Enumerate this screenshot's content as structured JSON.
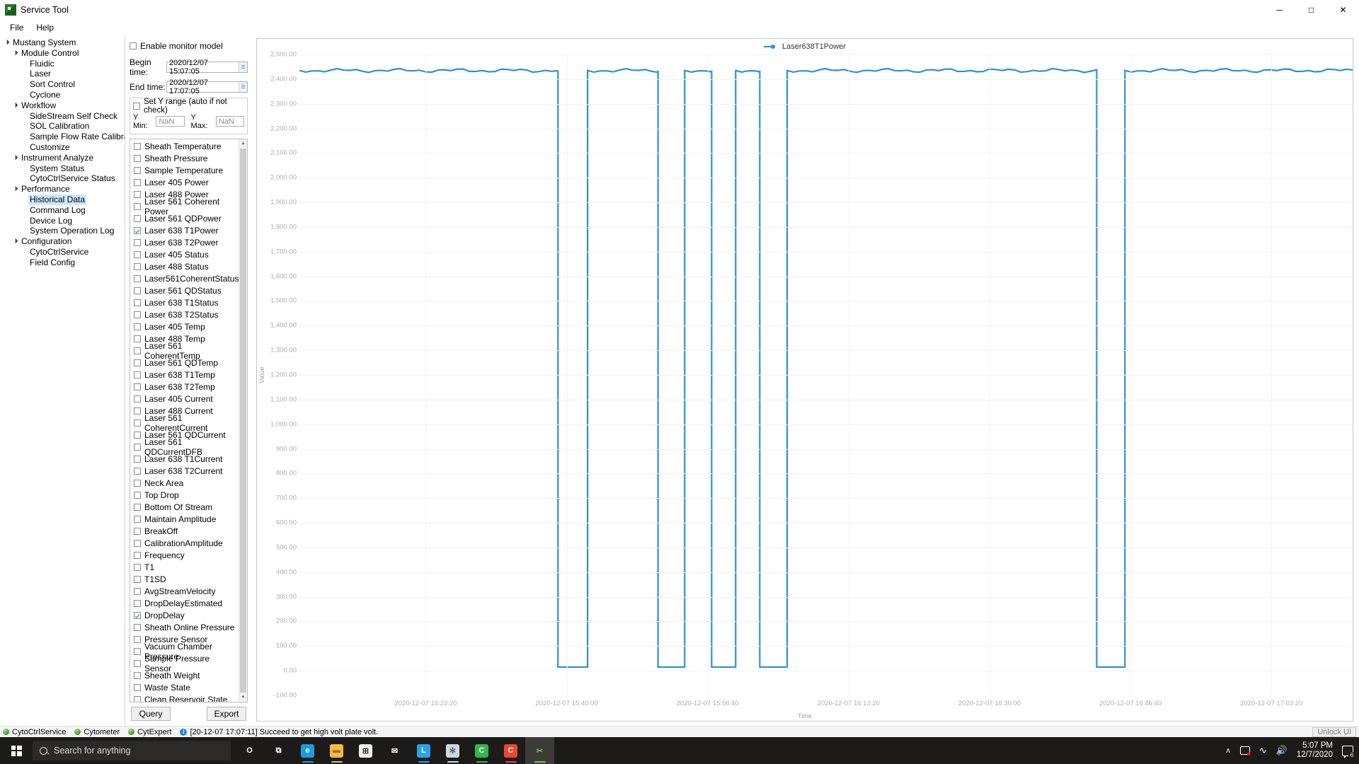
{
  "window": {
    "title": "Service Tool",
    "icon": "app-icon",
    "minimize": "─",
    "maximize": "□",
    "close": "✕"
  },
  "menubar": {
    "items": [
      "File",
      "Help"
    ]
  },
  "sidebar": {
    "items": [
      {
        "label": "Mustang System",
        "depth": 0,
        "arrow": "▴",
        "selected": false
      },
      {
        "label": "Module Control",
        "depth": 1,
        "arrow": "▴",
        "selected": false
      },
      {
        "label": "Fluidic",
        "depth": 2,
        "arrow": "",
        "selected": false
      },
      {
        "label": "Laser",
        "depth": 2,
        "arrow": "",
        "selected": false
      },
      {
        "label": "Sort Control",
        "depth": 2,
        "arrow": "",
        "selected": false
      },
      {
        "label": "Cyclone",
        "depth": 2,
        "arrow": "",
        "selected": false
      },
      {
        "label": "Workflow",
        "depth": 1,
        "arrow": "▴",
        "selected": false
      },
      {
        "label": "SideStream Self Check",
        "depth": 2,
        "arrow": "",
        "selected": false
      },
      {
        "label": "SOL Calibration",
        "depth": 2,
        "arrow": "",
        "selected": false
      },
      {
        "label": "Sample Flow Rate Calibration",
        "depth": 2,
        "arrow": "",
        "selected": false
      },
      {
        "label": "Customize",
        "depth": 2,
        "arrow": "",
        "selected": false
      },
      {
        "label": "Instrument Analyze",
        "depth": 1,
        "arrow": "▴",
        "selected": false
      },
      {
        "label": "System Status",
        "depth": 2,
        "arrow": "",
        "selected": false
      },
      {
        "label": "CytoCtrlService Status",
        "depth": 2,
        "arrow": "",
        "selected": false
      },
      {
        "label": "Performance",
        "depth": 1,
        "arrow": "▴",
        "selected": false
      },
      {
        "label": "Historical Data",
        "depth": 2,
        "arrow": "",
        "selected": true
      },
      {
        "label": "Command Log",
        "depth": 2,
        "arrow": "",
        "selected": false
      },
      {
        "label": "Device Log",
        "depth": 2,
        "arrow": "",
        "selected": false
      },
      {
        "label": "System Operation Log",
        "depth": 2,
        "arrow": "",
        "selected": false
      },
      {
        "label": "Configuration",
        "depth": 1,
        "arrow": "▴",
        "selected": false
      },
      {
        "label": "CytoCtrlService",
        "depth": 2,
        "arrow": "",
        "selected": false
      },
      {
        "label": "Field Config",
        "depth": 2,
        "arrow": "",
        "selected": false
      }
    ]
  },
  "controls": {
    "enable_monitor_label": "Enable monitor model",
    "enable_monitor_checked": false,
    "begin_time_label": "Begin time:",
    "begin_time_value": "2020/12/07 15:07:05",
    "end_time_label": "End time:",
    "end_time_value": "2020/12/07 17:07:05",
    "set_y_range_label": "Set Y range (auto if not check)",
    "set_y_range_checked": false,
    "y_min_label": "Y Min:",
    "y_min_value": "NaN",
    "y_max_label": "Y Max:",
    "y_max_value": "NaN",
    "query_button": "Query",
    "export_button": "Export",
    "scroll_up": "▲",
    "scroll_down": "▼"
  },
  "signal_list": [
    {
      "label": "Sheath Temperature",
      "checked": false
    },
    {
      "label": "Sheath Pressure",
      "checked": false
    },
    {
      "label": "Sample Temperature",
      "checked": false
    },
    {
      "label": "Laser 405 Power",
      "checked": false
    },
    {
      "label": "Laser 488 Power",
      "checked": false
    },
    {
      "label": "Laser 561 Coherent Power",
      "checked": false
    },
    {
      "label": "Laser 561 QDPower",
      "checked": false
    },
    {
      "label": "Laser 638 T1Power",
      "checked": true
    },
    {
      "label": "Laser 638 T2Power",
      "checked": false
    },
    {
      "label": "Laser 405 Status",
      "checked": false
    },
    {
      "label": "Laser 488 Status",
      "checked": false
    },
    {
      "label": "Laser561CoherentStatus",
      "checked": false
    },
    {
      "label": "Laser 561 QDStatus",
      "checked": false
    },
    {
      "label": "Laser 638 T1Status",
      "checked": false
    },
    {
      "label": "Laser 638 T2Status",
      "checked": false
    },
    {
      "label": "Laser 405 Temp",
      "checked": false
    },
    {
      "label": "Laser 488 Temp",
      "checked": false
    },
    {
      "label": "Laser 561 CoherentTemp",
      "checked": false
    },
    {
      "label": "Laser 561 QDTemp",
      "checked": false
    },
    {
      "label": "Laser 638 T1Temp",
      "checked": false
    },
    {
      "label": "Laser 638 T2Temp",
      "checked": false
    },
    {
      "label": "Laser 405 Current",
      "checked": false
    },
    {
      "label": "Laser 488 Current",
      "checked": false
    },
    {
      "label": "Laser 561 CoherentCurrent",
      "checked": false
    },
    {
      "label": "Laser 561 QDCurrent",
      "checked": false
    },
    {
      "label": "Laser 561 QDCurrentDFB",
      "checked": false
    },
    {
      "label": "Laser 638 T1Current",
      "checked": false
    },
    {
      "label": "Laser 638 T2Current",
      "checked": false
    },
    {
      "label": "Neck Area",
      "checked": false
    },
    {
      "label": "Top Drop",
      "checked": false
    },
    {
      "label": "Bottom Of Stream",
      "checked": false
    },
    {
      "label": "Maintain Amplitude",
      "checked": false
    },
    {
      "label": "BreakOff",
      "checked": false
    },
    {
      "label": "CalibrationAmplitude",
      "checked": false
    },
    {
      "label": "Frequency",
      "checked": false
    },
    {
      "label": "T1",
      "checked": false
    },
    {
      "label": "T1SD",
      "checked": false
    },
    {
      "label": "AvgStreamVelocity",
      "checked": false
    },
    {
      "label": "DropDelayEstimated",
      "checked": false
    },
    {
      "label": "DropDelay",
      "checked": true
    },
    {
      "label": "Sheath Online Pressure",
      "checked": false
    },
    {
      "label": "Pressure Sensor",
      "checked": false
    },
    {
      "label": "Vacuum Chamber Pressure",
      "checked": false
    },
    {
      "label": "Sample Pressure Sensor",
      "checked": false
    },
    {
      "label": "Sheath Weight",
      "checked": false
    },
    {
      "label": "Waste State",
      "checked": false
    },
    {
      "label": "Clean Reservoir State",
      "checked": false
    }
  ],
  "chart_data": {
    "type": "line",
    "title": "",
    "legend": [
      "Laser638T1Power"
    ],
    "legend_position": "top-center",
    "series_color": "#2f8fd6",
    "xlabel": "Time",
    "ylabel": "Value",
    "grid": true,
    "ylim": [
      -100,
      2500
    ],
    "yticks": [
      "2,500.00",
      "2,400.00",
      "2,300.00",
      "2,200.00",
      "2,100.00",
      "2,000.00",
      "1,900.00",
      "1,800.00",
      "1,700.00",
      "1,600.00",
      "1,500.00",
      "1,400.00",
      "1,300.00",
      "1,200.00",
      "1,100.00",
      "1,000.00",
      "900.00",
      "800.00",
      "700.00",
      "600.00",
      "500.00",
      "400.00",
      "300.00",
      "200.00",
      "100.00",
      "0.00",
      "-100.00"
    ],
    "ytick_values": [
      2500,
      2400,
      2300,
      2200,
      2100,
      2000,
      1900,
      1800,
      1700,
      1600,
      1500,
      1400,
      1300,
      1200,
      1100,
      1000,
      900,
      800,
      700,
      600,
      500,
      400,
      300,
      200,
      100,
      0,
      -100
    ],
    "xticks": [
      "2020-12-07 15:23:20",
      "2020-12-07 15:40:00",
      "2020-12-07 15:56:40",
      "2020-12-07 16:13:20",
      "2020-12-07 16:30:00",
      "2020-12-07 16:46:40",
      "2020-12-07 17:03:20"
    ],
    "xtick_positions": [
      0.1199,
      0.2538,
      0.3876,
      0.5214,
      0.6553,
      0.7891,
      0.9229
    ],
    "x_start": "2020-12-07 15:07:05",
    "x_end": "2020-12-07 17:07:05",
    "series": [
      {
        "name": "Laser638T1Power",
        "high_value": 2435,
        "low_value": 15,
        "segments_on": [
          [
            0.0,
            0.2455
          ],
          [
            0.2736,
            0.3405
          ],
          [
            0.3658,
            0.3914
          ],
          [
            0.4142,
            0.4371
          ],
          [
            0.4631,
            0.757
          ],
          [
            0.7838,
            1.0
          ]
        ],
        "segments_off": [
          [
            0.2455,
            0.2736
          ],
          [
            0.3405,
            0.3658
          ],
          [
            0.3914,
            0.4142
          ],
          [
            0.4371,
            0.4631
          ],
          [
            0.757,
            0.7838
          ]
        ]
      }
    ]
  },
  "statusbar": {
    "services": [
      {
        "label": "CytoCtrlService",
        "status": "green"
      },
      {
        "label": "Cytometer",
        "status": "green"
      },
      {
        "label": "CytExpert",
        "status": "green"
      }
    ],
    "info_icon": "i",
    "message": "[20-12-07 17:07:11] Succeed to get high volt plate volt.",
    "unlock_button": "Unlock UI"
  },
  "taskbar": {
    "search_placeholder": "Search for anything",
    "apps": [
      {
        "name": "cortana-icon",
        "glyph": "O",
        "bg": "transparent",
        "color": "#ffffff",
        "under": ""
      },
      {
        "name": "task-view-icon",
        "glyph": "⧉",
        "bg": "transparent",
        "color": "#ffffff",
        "under": ""
      },
      {
        "name": "edge-icon",
        "glyph": "e",
        "bg": "#1b9de2",
        "color": "#ffffff",
        "under": "#1b9de2"
      },
      {
        "name": "file-explorer-icon",
        "glyph": "▬",
        "bg": "#f5b942",
        "color": "#9a6a00",
        "under": "#f5b942"
      },
      {
        "name": "microsoft-store-icon",
        "glyph": "⊞",
        "bg": "#f2f2f2",
        "color": "#333333",
        "under": ""
      },
      {
        "name": "mail-icon",
        "glyph": "✉",
        "bg": "transparent",
        "color": "#ffffff",
        "under": ""
      },
      {
        "name": "l-app-icon",
        "glyph": "L",
        "bg": "#2aa3e8",
        "color": "#ffffff",
        "under": "#2aa3e8"
      },
      {
        "name": "snowflake-app-icon",
        "glyph": "✻",
        "bg": "#cfd8df",
        "color": "#5b6b77",
        "under": "#cfd8df"
      },
      {
        "name": "c-green-app-icon",
        "glyph": "C",
        "bg": "#35b44b",
        "color": "#ffffff",
        "under": "#35b44b"
      },
      {
        "name": "c-red-app-icon",
        "glyph": "C",
        "bg": "#ef4530",
        "color": "#ffffff",
        "under": "#ef4530"
      },
      {
        "name": "service-tool-icon",
        "glyph": "✂",
        "bg": "transparent",
        "color": "#7bc144",
        "under": "#7bc144"
      }
    ],
    "tray": {
      "chevron": "∧",
      "network_icon": "network-icon",
      "wifi_icon": "wifi-icon",
      "volume_icon": "ᴘ",
      "time": "5:07 PM",
      "date": "12/7/2020",
      "notification_count": "6"
    }
  }
}
